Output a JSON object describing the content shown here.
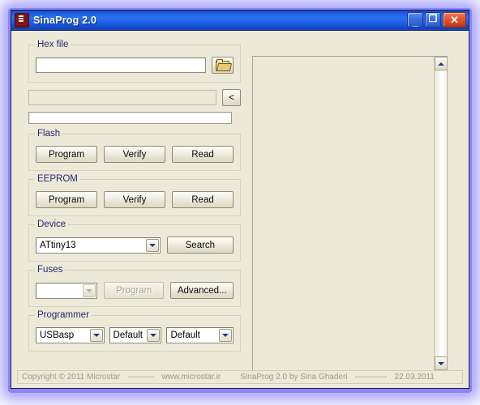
{
  "window": {
    "title": "SinaProg 2.0",
    "app_icon": "sinaprog-icon",
    "controls": {
      "minimize": "_",
      "maximize": "❐",
      "close": "✕"
    }
  },
  "colors": {
    "face": "#ECE9D8",
    "group_label": "#262673",
    "titlebar_blue": "#2A6FF0",
    "close_red": "#E2552F",
    "glow": "#8B85F5"
  },
  "hex_file": {
    "label": "Hex file",
    "path_value": "",
    "path_placeholder": "",
    "browse_icon": "open-folder-icon"
  },
  "secondary": {
    "field_value": "",
    "back_button_label": "<"
  },
  "progress": {
    "value": 0,
    "max": 100
  },
  "flash": {
    "label": "Flash",
    "buttons": [
      "Program",
      "Verify",
      "Read"
    ]
  },
  "eeprom": {
    "label": "EEPROM",
    "buttons": [
      "Program",
      "Verify",
      "Read"
    ]
  },
  "device": {
    "label": "Device",
    "selected": "ATtiny13",
    "search_label": "Search"
  },
  "fuses": {
    "label": "Fuses",
    "selected": "",
    "program_label": "Program",
    "program_enabled": false,
    "advanced_label": "Advanced..."
  },
  "programmer": {
    "label": "Programmer",
    "interface_selected": "USBasp",
    "port_selected": "Default",
    "speed_selected": "Default"
  },
  "log": {
    "content": "",
    "scrollbar": {
      "up_icon": "chevron-up-icon",
      "down_icon": "chevron-down-icon"
    }
  },
  "footer": {
    "copyright": "Copyright © 2011 Microstar",
    "dashes_1": "----------",
    "website": "www.microstar.ir",
    "credit": "SinaProg 2.0  by  Sina Ghaderi",
    "dashes_2": "------------",
    "date": "22.03.2011"
  }
}
